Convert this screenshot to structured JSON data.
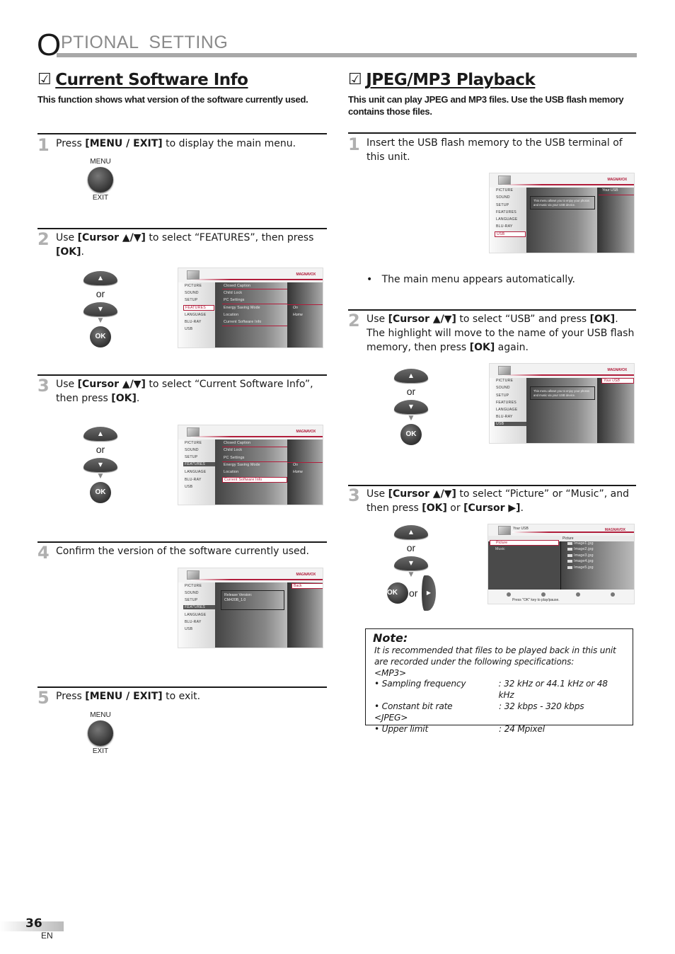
{
  "header": {
    "first_letter": "O",
    "rest": "PTIONAL  SETTING"
  },
  "left_section": {
    "checkbox": "☑",
    "title": "Current Software Info",
    "description": "This function shows what version of the software currently used.",
    "steps": [
      {
        "num": "1",
        "pre": "Press ",
        "bold": "[MENU / EXIT]",
        "post": " to display the main menu."
      },
      {
        "num": "2",
        "pre": "Use ",
        "bold": "[Cursor ▲/▼]",
        "post": " to select “FEATURES”, then press ",
        "bold2": "[OK]",
        "post2": "."
      },
      {
        "num": "3",
        "pre": "Use ",
        "bold": "[Cursor ▲/▼]",
        "post": " to select “Current Software Info”, then press ",
        "bold2": "[OK]",
        "post2": "."
      },
      {
        "num": "4",
        "text": "Confirm the version of the software currently used."
      },
      {
        "num": "5",
        "pre": "Press ",
        "bold": "[MENU / EXIT]",
        "post": " to exit."
      }
    ]
  },
  "right_section": {
    "checkbox": "☑",
    "title": "JPEG/MP3 Playback",
    "description": "This unit can play JPEG and MP3 files. Use the USB flash memory contains those files.",
    "steps": [
      {
        "num": "1",
        "text": "Insert the USB flash memory to the USB terminal of this unit."
      },
      {
        "num": "2",
        "pre": "Use ",
        "bold": "[Cursor ▲/▼]",
        "post": " to select “USB” and press ",
        "bold2": "[OK]",
        "post2": ". The highlight will move to the name of your USB flash memory, then press ",
        "bold3": "[OK]",
        "post3": " again."
      },
      {
        "num": "3",
        "pre": "Use ",
        "bold": "[Cursor ▲/▼]",
        "post": " to select “Picture” or “Music”, and then press ",
        "bold2": "[OK]",
        "post2": " or ",
        "bold3": "[Cursor ▶]",
        "post3": "."
      }
    ],
    "bullet": "The main menu appears automatically."
  },
  "remote": {
    "menu_top": "MENU",
    "menu_bottom": "EXIT",
    "or": "or",
    "ok": "OK",
    "up": "▲",
    "down": "▼",
    "right": "▶",
    "arrow_down": "▼"
  },
  "tv": {
    "brand": "MAGNAVOX",
    "main_menu": [
      "PICTURE",
      "SOUND",
      "SETUP",
      "FEATURES",
      "LANGUAGE",
      "BLU-RAY",
      "USB"
    ],
    "features_menu": [
      "Closed Caption",
      "Child Lock",
      "PC Settings",
      "Energy Saving Mode",
      "Location",
      "Current Software Info"
    ],
    "features_values": [
      "On",
      "Home"
    ],
    "release_label": "Release Version:",
    "release_value": "CM420B_1.0",
    "back": "Back",
    "usb_desc": "This menu allows you to enjoy your photos and music via your USB device.",
    "your_usb": "Your USB",
    "media_types": [
      "Picture",
      "Music"
    ],
    "picture_header": "Picture",
    "files": [
      "Image1.jpg",
      "Image2.jpg",
      "Image3.jpg",
      "Image4.jpg",
      "Image5.jpg"
    ],
    "footer_hint": "Press \"OK\" key to play/pause."
  },
  "note": {
    "heading": "Note:",
    "intro": "It is recommended that files to be played back in this unit are recorded under the following specifications:",
    "mp3_label": "<MP3>",
    "mp3_specs": [
      {
        "key": "• Sampling frequency",
        "value": ": 32 kHz or 44.1 kHz or 48 kHz"
      },
      {
        "key": "• Constant bit rate",
        "value": ": 32 kbps - 320 kbps"
      }
    ],
    "jpeg_label": "<JPEG>",
    "jpeg_specs": [
      {
        "key": "• Upper limit",
        "value": ": 24 Mpixel"
      }
    ]
  },
  "footer": {
    "page": "36",
    "lang": "EN"
  }
}
